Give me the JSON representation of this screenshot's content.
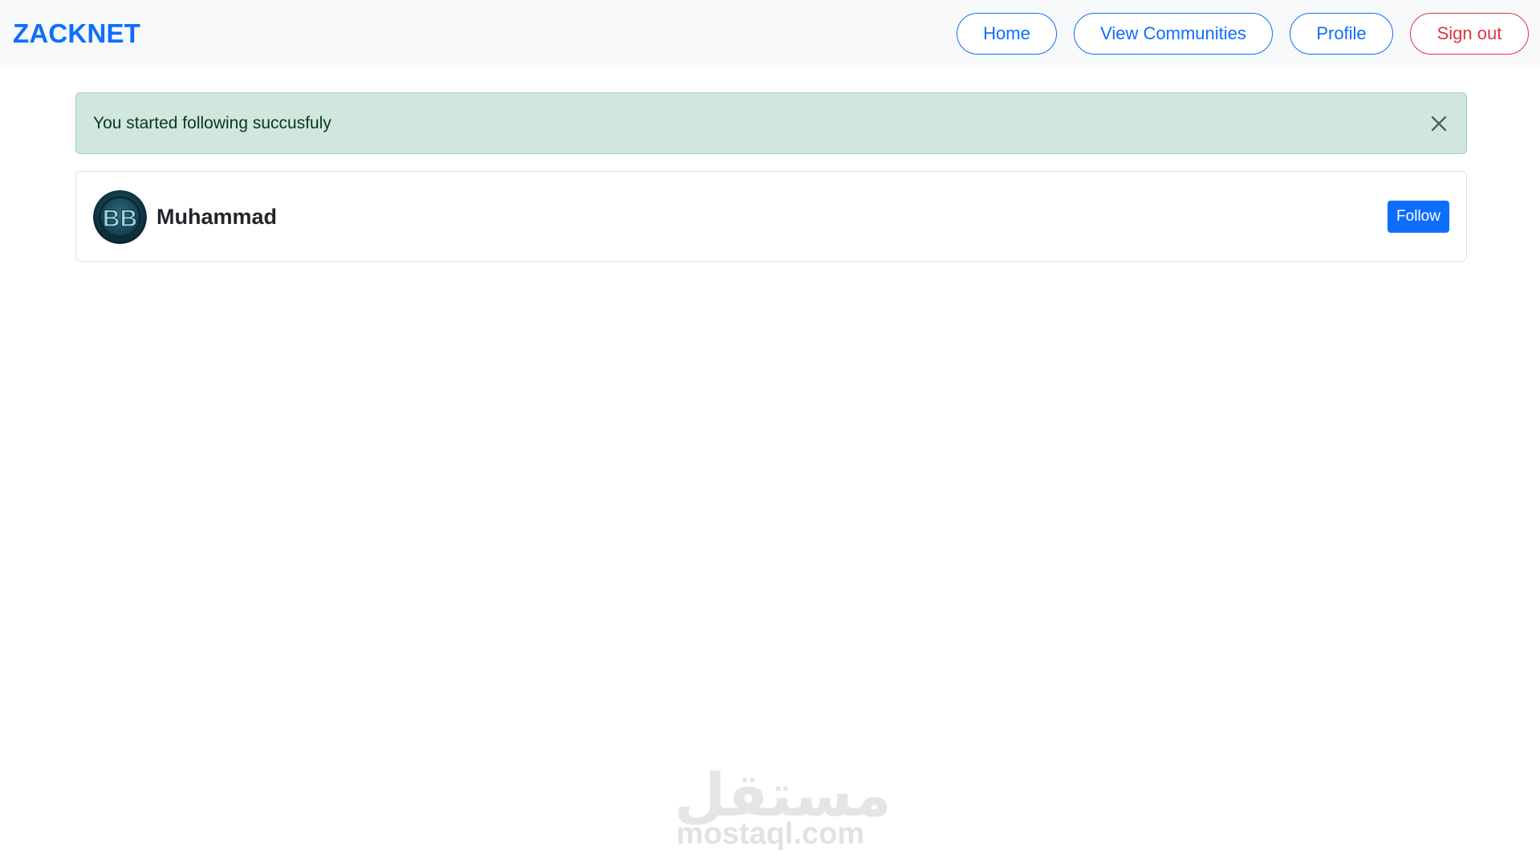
{
  "navbar": {
    "brand": "ZACKNET",
    "links": {
      "home": "Home",
      "communities": "View Communities",
      "profile": "Profile",
      "signout": "Sign out"
    }
  },
  "alert": {
    "message": "You started following succusfuly",
    "close_icon": "close-icon"
  },
  "user": {
    "name": "Muhammad",
    "avatar_initials": "BB",
    "follow_label": "Follow"
  },
  "watermark": {
    "arabic": "مستقل",
    "latin": "mostaql.com"
  },
  "colors": {
    "primary": "#0d6efd",
    "danger": "#dc3545",
    "alert_bg": "#d1e7dd",
    "navbar_bg": "#f8f9fa"
  }
}
